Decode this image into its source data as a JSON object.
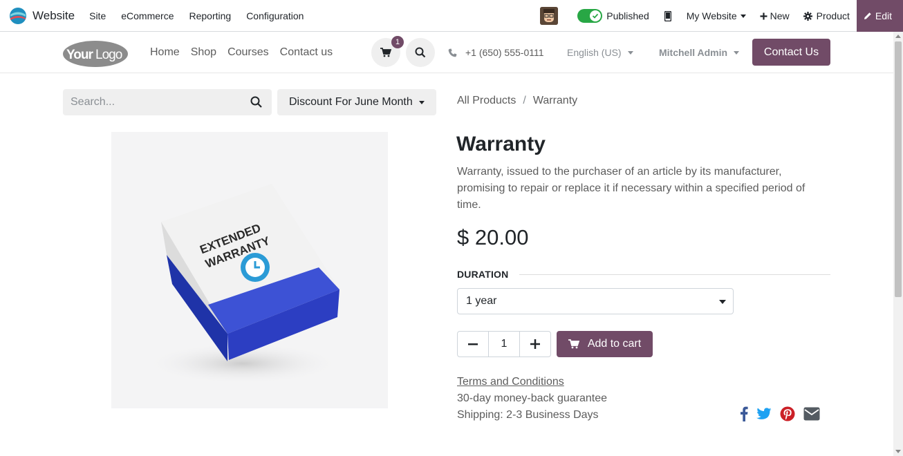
{
  "adminbar": {
    "app_name": "Website",
    "menus": [
      "Site",
      "eCommerce",
      "Reporting",
      "Configuration"
    ],
    "published_label": "Published",
    "website_label": "My Website",
    "new_label": "New",
    "product_label": "Product",
    "edit_label": "Edit"
  },
  "header": {
    "logo_text": "YourLogo",
    "nav": [
      "Home",
      "Shop",
      "Courses",
      "Contact us"
    ],
    "cart_count": "1",
    "phone": "+1 (650) 555-0111",
    "language": "English (US)",
    "user": "Mitchell Admin",
    "contact_button": "Contact Us"
  },
  "shop": {
    "search_placeholder": "Search...",
    "pricelist": "Discount For June Month",
    "breadcrumb": [
      "All Products",
      "Warranty"
    ]
  },
  "product": {
    "image_text_line1": "EXTENDED",
    "image_text_line2": "WARRANTY",
    "title": "Warranty",
    "description": "Warranty, issued to the purchaser of an article by its manufacturer, promising to repair or replace it if necessary within a specified period of time.",
    "price": "$ 20.00",
    "attribute_label": "DURATION",
    "attribute_value": "1 year",
    "quantity": "1",
    "add_to_cart": "Add to cart",
    "terms": "Terms and Conditions",
    "guarantee": "30-day money-back guarantee",
    "shipping": "Shipping: 2-3 Business Days"
  },
  "colors": {
    "brand": "#714b67",
    "published": "#28a745"
  }
}
